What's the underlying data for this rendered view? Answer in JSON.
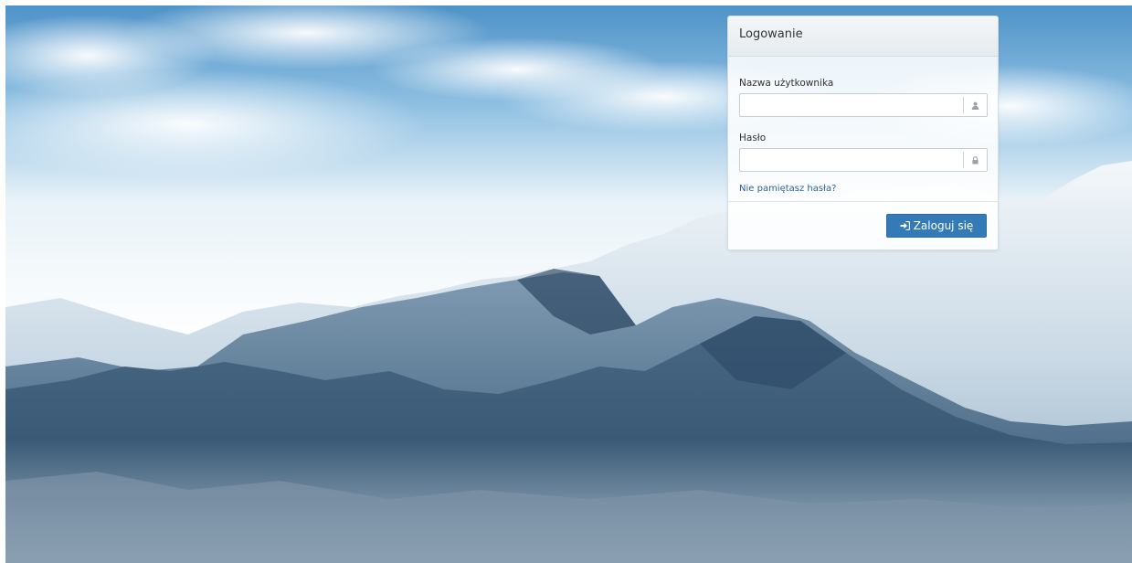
{
  "background": {
    "description_icon": "mountain-landscape",
    "sky_color": "#5f9fd0",
    "snow_color": "#eef4f8",
    "forest_color": "#2c4a66"
  },
  "login": {
    "title": "Logowanie",
    "username_label": "Nazwa użytkownika",
    "username_value": "",
    "username_icon": "user-icon",
    "password_label": "Hasło",
    "password_value": "",
    "password_icon": "lock-icon",
    "forgot_link": "Nie pamiętasz hasła?",
    "submit_label": "Zaloguj się",
    "submit_icon": "sign-in-icon",
    "accent_color": "#337ab7"
  }
}
